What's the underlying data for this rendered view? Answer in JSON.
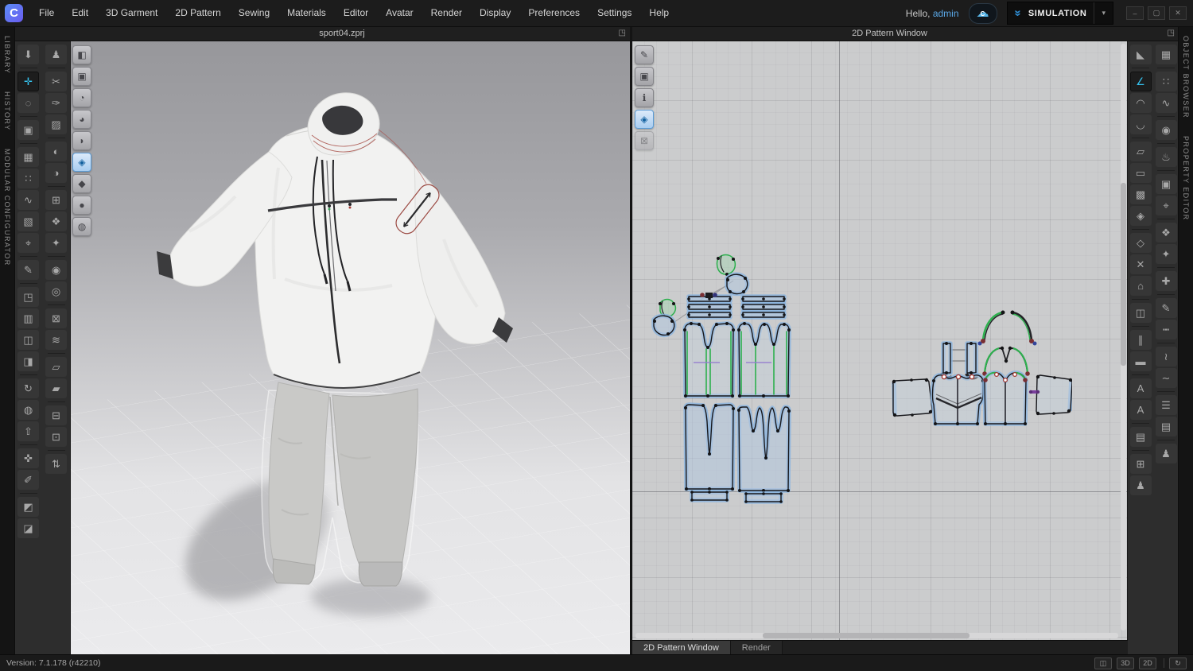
{
  "topbar": {
    "logo_glyph": "C",
    "menus": [
      {
        "name": "menu-file",
        "label": "File"
      },
      {
        "name": "menu-edit",
        "label": "Edit"
      },
      {
        "name": "menu-3d-garment",
        "label": "3D Garment"
      },
      {
        "name": "menu-2d-pattern",
        "label": "2D Pattern"
      },
      {
        "name": "menu-sewing",
        "label": "Sewing"
      },
      {
        "name": "menu-materials",
        "label": "Materials"
      },
      {
        "name": "menu-editor",
        "label": "Editor"
      },
      {
        "name": "menu-avatar",
        "label": "Avatar"
      },
      {
        "name": "menu-render",
        "label": "Render"
      },
      {
        "name": "menu-display",
        "label": "Display"
      },
      {
        "name": "menu-preferences",
        "label": "Preferences"
      },
      {
        "name": "menu-settings",
        "label": "Settings"
      },
      {
        "name": "menu-help",
        "label": "Help"
      }
    ],
    "greeting": "Hello,",
    "username": "admin",
    "cloud_glyph": "☁",
    "cloud_letter": "C",
    "simulation_chevron_glyph": "»",
    "simulation_label": "SIMULATION",
    "simulation_caret": "▾",
    "window_controls": [
      {
        "name": "minimize-button",
        "glyph": "–"
      },
      {
        "name": "restore-button",
        "glyph": "▢"
      },
      {
        "name": "close-button",
        "glyph": "✕"
      }
    ]
  },
  "left_rail": {
    "tabs": [
      {
        "name": "tab-library",
        "label": "LIBRARY"
      },
      {
        "name": "tab-history",
        "label": "HISTORY"
      },
      {
        "name": "tab-modular-configurator",
        "label": "MODULAR CONFIGURATOR"
      }
    ]
  },
  "right_rail": {
    "tabs": [
      {
        "name": "tab-object-browser",
        "label": "OBJECT BROWSER"
      },
      {
        "name": "tab-property-editor",
        "label": "PROPERTY EDITOR"
      }
    ]
  },
  "panel3d": {
    "title": "sport04.zprj",
    "popout_glyph": "◳"
  },
  "panel2d": {
    "title": "2D Pattern Window",
    "popout_glyph": "◳"
  },
  "toolbars": {
    "left_col1": [
      {
        "name": "gizmo-arrow-tool",
        "glyph": "⬇"
      },
      {
        "sep": true
      },
      {
        "name": "select-move-tool",
        "glyph": "✛",
        "active": true
      },
      {
        "name": "select-mesh-tool",
        "glyph": "◌"
      },
      {
        "sep": true
      },
      {
        "name": "select-garment-tool",
        "glyph": "▣"
      },
      {
        "sep": true
      },
      {
        "name": "sewing-machine-tool",
        "glyph": "▦"
      },
      {
        "name": "segment-sewing-tool",
        "glyph": "∷"
      },
      {
        "name": "free-sewing-tool",
        "glyph": "∿"
      },
      {
        "name": "edit-sewing-tool",
        "glyph": "▧"
      },
      {
        "name": "pin-tool",
        "glyph": "⌖"
      },
      {
        "sep": true
      },
      {
        "name": "pen-3d-tool",
        "glyph": "✎"
      },
      {
        "sep": true
      },
      {
        "name": "flatten-tool",
        "glyph": "◳"
      },
      {
        "name": "fur-jacket-tool",
        "glyph": "▥"
      },
      {
        "name": "layer-clone-tool",
        "glyph": "◫"
      },
      {
        "name": "open-garment-tool",
        "glyph": "◨"
      },
      {
        "sep": true
      },
      {
        "name": "rotate-object-tool",
        "glyph": "↻"
      },
      {
        "name": "avatar-display-tool",
        "glyph": "◍"
      },
      {
        "name": "lift-garment-tool",
        "glyph": "⇧"
      },
      {
        "sep": true
      },
      {
        "name": "tape-measure-tool",
        "glyph": "✜"
      },
      {
        "name": "ruler-tool",
        "glyph": "✐"
      },
      {
        "sep": true
      },
      {
        "name": "arrange-shirt-tool",
        "glyph": "◩"
      },
      {
        "name": "solid-shirt-tool",
        "glyph": "◪"
      }
    ],
    "left_col2": [
      {
        "name": "avatar-pose-tool",
        "glyph": "♟"
      },
      {
        "sep": true
      },
      {
        "name": "scissor-cut-tool",
        "glyph": "✂"
      },
      {
        "name": "cut-sew-tool",
        "glyph": "✑"
      },
      {
        "name": "slash-spread-tool",
        "glyph": "▨"
      },
      {
        "sep": true
      },
      {
        "name": "tuck-garment-tool",
        "glyph": "◐"
      },
      {
        "name": "fold-garment-tool",
        "glyph": "◑"
      },
      {
        "sep": true
      },
      {
        "name": "fit-shoe-tool",
        "glyph": "⊞"
      },
      {
        "name": "grade-shirt-tool",
        "glyph": "❖"
      },
      {
        "name": "dot-shirt-tool",
        "glyph": "✦"
      },
      {
        "sep": true
      },
      {
        "name": "button-tool",
        "glyph": "◉"
      },
      {
        "name": "buttonhole-tool",
        "glyph": "◎"
      },
      {
        "sep": true
      },
      {
        "name": "lock-trim-tool",
        "glyph": "⊠"
      },
      {
        "name": "zipper-tool",
        "glyph": "≋"
      },
      {
        "sep": true
      },
      {
        "name": "trim-piece-tool",
        "glyph": "▱"
      },
      {
        "name": "trim-roll-tool",
        "glyph": "▰"
      },
      {
        "sep": true
      },
      {
        "name": "fabric-piece-tool",
        "glyph": "⊟"
      },
      {
        "name": "fabric-roll-tool",
        "glyph": "⊡"
      },
      {
        "sep": true
      },
      {
        "name": "stitch-pin-tool",
        "glyph": "⇅"
      }
    ],
    "right_col1": [
      {
        "name": "transform-pattern-tool",
        "glyph": "◣"
      },
      {
        "sep": true
      },
      {
        "name": "edit-pattern-tool",
        "glyph": "∠",
        "active": true
      },
      {
        "name": "edit-curvature-tool",
        "glyph": "◠"
      },
      {
        "name": "edit-curve-point-tool",
        "glyph": "◡"
      },
      {
        "sep": true
      },
      {
        "name": "polygon-pattern-tool",
        "glyph": "▱"
      },
      {
        "name": "rectangle-pattern-tool",
        "glyph": "▭"
      },
      {
        "name": "trace-pattern-tool",
        "glyph": "▩"
      },
      {
        "name": "seam-allowance-tool",
        "glyph": "◈"
      },
      {
        "sep": true
      },
      {
        "name": "dart-tool",
        "glyph": "◇"
      },
      {
        "name": "notch-point-tool",
        "glyph": "✕"
      },
      {
        "name": "pattern-shape-tool",
        "glyph": "⌂"
      },
      {
        "sep": true
      },
      {
        "name": "fold-cylinder-tool",
        "glyph": "◫"
      },
      {
        "sep": true
      },
      {
        "name": "zipper-2d-tool",
        "glyph": "∥"
      },
      {
        "name": "binding-band-tool",
        "glyph": "▬"
      },
      {
        "sep": true
      },
      {
        "name": "text-edit-tool",
        "glyph": "A"
      },
      {
        "name": "text-pattern-tool",
        "glyph": "A"
      },
      {
        "sep": true
      },
      {
        "name": "quilting-tool",
        "glyph": "▤"
      },
      {
        "sep": true
      },
      {
        "name": "fabric-swap-2d-tool",
        "glyph": "⊞"
      },
      {
        "name": "walk-figure-tool",
        "glyph": "♟"
      }
    ],
    "right_col2": [
      {
        "name": "sewing-machine-2d-tool",
        "glyph": "▦"
      },
      {
        "sep": true
      },
      {
        "name": "segment-sewing-2d-tool",
        "glyph": "∷"
      },
      {
        "name": "free-sewing-2d-tool",
        "glyph": "∿"
      },
      {
        "sep": true
      },
      {
        "name": "detail-sewing-tool",
        "glyph": "◉"
      },
      {
        "sep": true
      },
      {
        "name": "steam-iron-tool",
        "glyph": "♨"
      },
      {
        "sep": true
      },
      {
        "name": "select-garment-2d-tool",
        "glyph": "▣"
      },
      {
        "name": "pin-2d-tool",
        "glyph": "⌖"
      },
      {
        "sep": true
      },
      {
        "name": "grading-shirt-tool",
        "glyph": "❖"
      },
      {
        "name": "grading-dots-tool",
        "glyph": "✦"
      },
      {
        "sep": true
      },
      {
        "name": "basting-tool",
        "glyph": "✚"
      },
      {
        "sep": true
      },
      {
        "name": "pen-line-tool",
        "glyph": "✎"
      },
      {
        "name": "dashed-line-tool",
        "glyph": "┅"
      },
      {
        "sep": true
      },
      {
        "name": "shirring-tool",
        "glyph": "≀"
      },
      {
        "name": "elastic-wave-tool",
        "glyph": "∼"
      },
      {
        "sep": true
      },
      {
        "name": "pleats-fold-tool",
        "glyph": "☰"
      },
      {
        "name": "pleats-fabric-tool",
        "glyph": "▤"
      },
      {
        "sep": true
      },
      {
        "name": "mannequin-small-tool",
        "glyph": "♟"
      }
    ],
    "view3d_toggles": [
      {
        "name": "show-thickness-toggle",
        "glyph": "◧"
      },
      {
        "name": "show-garment-texture-toggle",
        "glyph": "▣"
      },
      {
        "name": "show-garment-fit-toggle",
        "glyph": "◔"
      },
      {
        "name": "show-avatar-texture-toggle",
        "glyph": "◕"
      },
      {
        "name": "show-avatar-toggle",
        "glyph": "◗"
      },
      {
        "name": "show-pattern-book-toggle",
        "glyph": "◈",
        "active": true
      },
      {
        "name": "show-surface-toggle",
        "glyph": "◆"
      },
      {
        "name": "show-silhouette-toggle",
        "glyph": "●"
      },
      {
        "name": "show-environment-toggle",
        "glyph": "◍"
      }
    ],
    "view2d_toggles": [
      {
        "name": "show-stitches-toggle",
        "glyph": "✎"
      },
      {
        "name": "show-garment-2d-toggle",
        "glyph": "▣"
      },
      {
        "name": "show-info-toggle",
        "glyph": "ℹ"
      },
      {
        "name": "show-pattern-2d-toggle",
        "glyph": "◈",
        "active": true
      },
      {
        "name": "lock-pattern-toggle",
        "glyph": "⊠",
        "disabled": true
      }
    ]
  },
  "bottom_tabs": [
    {
      "name": "tab-2d-pattern-window",
      "label": "2D Pattern Window",
      "active": true
    },
    {
      "name": "tab-render",
      "label": "Render"
    }
  ],
  "status_bar": {
    "version": "Version: 7.1.178 (r42210)",
    "right_buttons": [
      {
        "name": "split-view-button",
        "glyph": "◫"
      },
      {
        "name": "view-3d-button",
        "label": "3D"
      },
      {
        "name": "view-2d-button",
        "label": "2D"
      },
      {
        "sep": true
      },
      {
        "name": "sync-button",
        "glyph": "↻"
      }
    ]
  },
  "colors": {
    "accent_blue": "#58b6ea",
    "admin_text": "#5aa8e8",
    "tool_active": "#35c3f0",
    "selection_halo": "#8ab4e0",
    "pattern_green": "#2db04e",
    "pattern_purple": "#947ccd",
    "canvas_2d": "#cbcccd"
  }
}
